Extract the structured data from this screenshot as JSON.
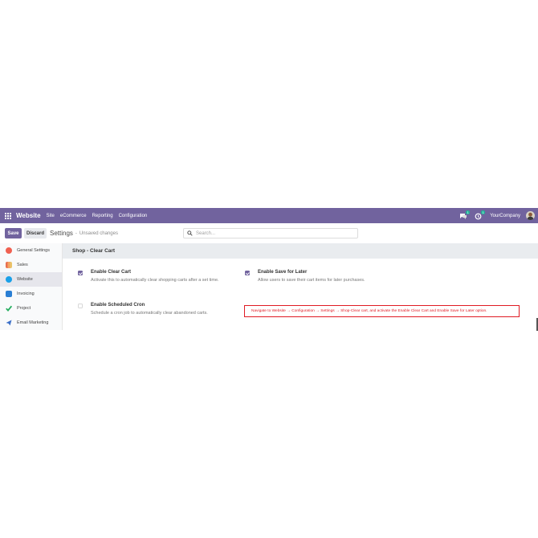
{
  "navbar": {
    "brand": "Website",
    "menu": [
      "Site",
      "eCommerce",
      "Reporting",
      "Configuration"
    ],
    "chat_badge": "1",
    "activity_badge": "1",
    "company": "YourCompany"
  },
  "control_panel": {
    "save_label": "Save",
    "discard_label": "Discard",
    "title": "Settings",
    "separator": "-",
    "status": "Unsaved changes",
    "search_placeholder": "Search..."
  },
  "sidebar": {
    "items": [
      {
        "label": "General Settings",
        "color": "#f06050"
      },
      {
        "label": "Sales",
        "color": "#f4a261"
      },
      {
        "label": "Website",
        "color": "#1aa0e8"
      },
      {
        "label": "Invoicing",
        "color": "#2a7fd4"
      },
      {
        "label": "Project",
        "color": "#27ae60"
      },
      {
        "label": "Email Marketing",
        "color": "#3b6fc8"
      }
    ]
  },
  "section": {
    "title": "Shop - Clear Cart",
    "settings": [
      {
        "label": "Enable Clear Cart",
        "help": "Activate this to automatically clear shopping carts after a set time.",
        "checked": true
      },
      {
        "label": "Enable Save for Later",
        "help": "Allow users to save their cart items for later purchases.",
        "checked": true
      },
      {
        "label": "Enable Scheduled Cron",
        "help": "Schedule a cron job to automatically clear abandoned carts.",
        "checked": false
      }
    ]
  },
  "callout": "Navigate to Website → Configuration → Settings → Shop-Clear cart, and activate the Enable Clear Cart and Enable Save for Later option.",
  "colors": {
    "accent": "#71639e",
    "callout": "#e01b24"
  }
}
